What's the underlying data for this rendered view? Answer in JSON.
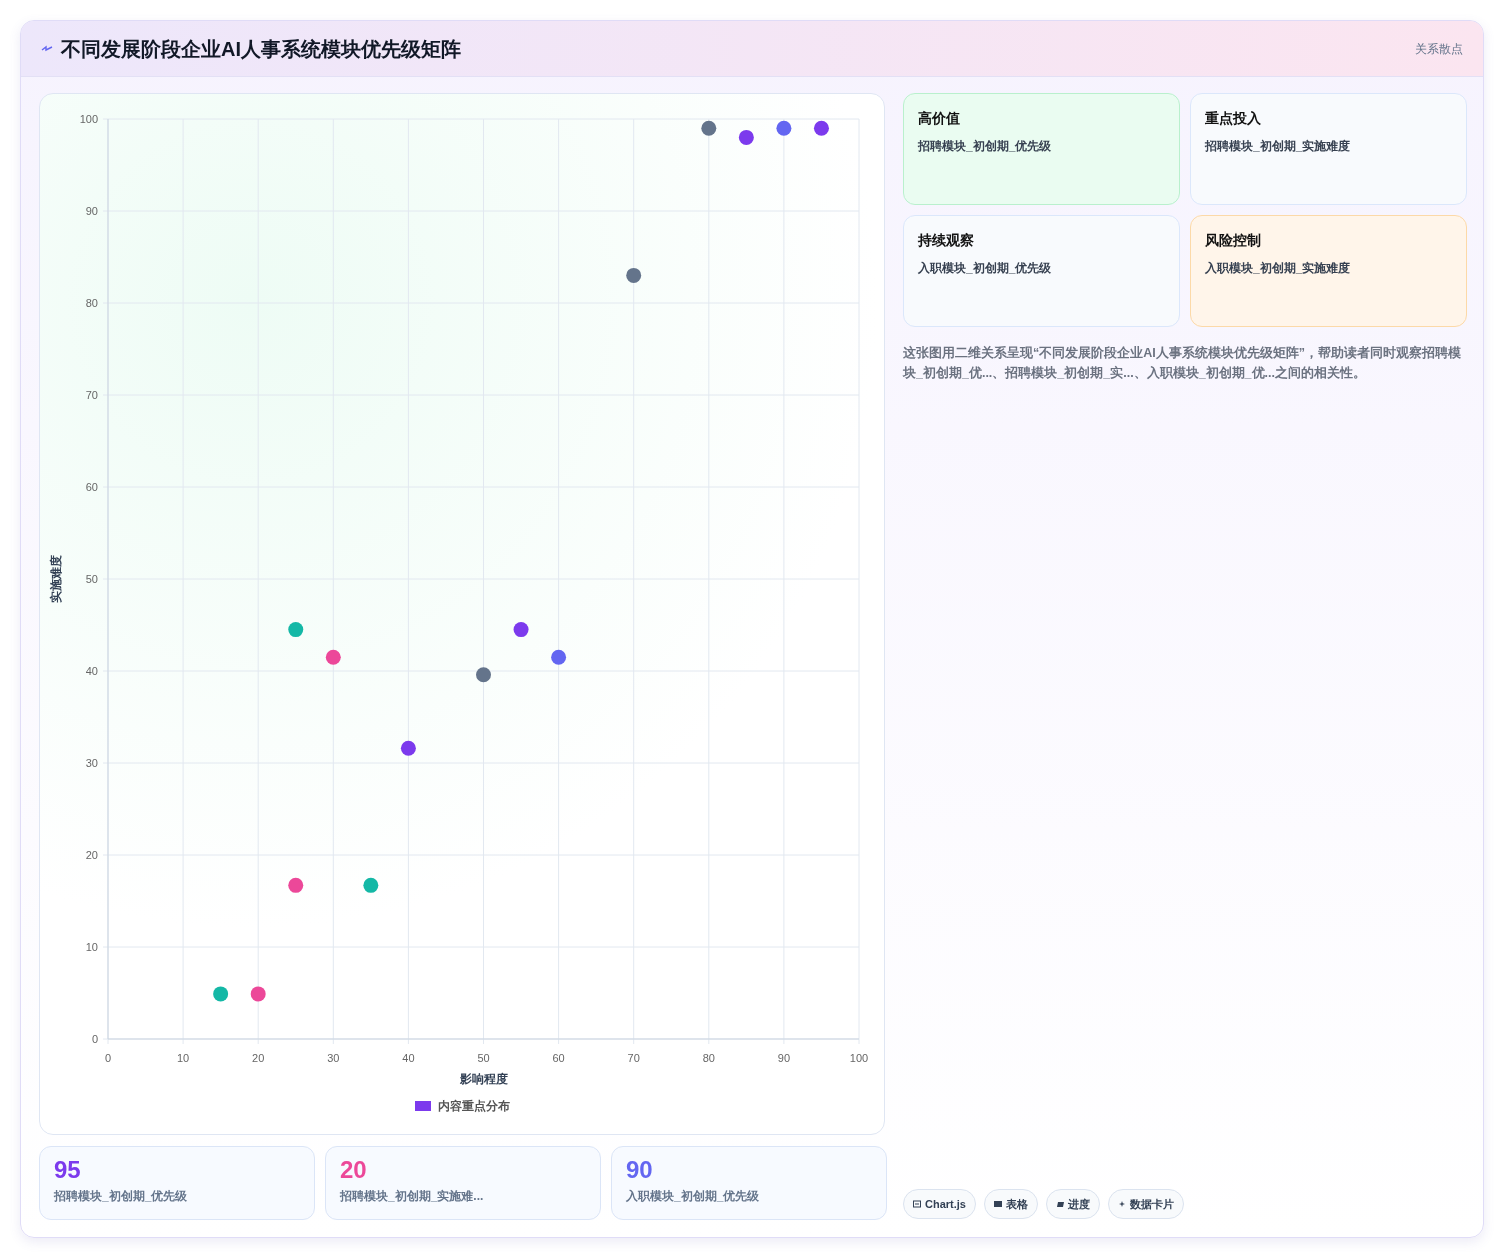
{
  "header": {
    "title": "不同发展阶段企业AI人事系统模块优先级矩阵",
    "tag": "关系散点"
  },
  "chart": {
    "chart_data": {
      "type": "scatter",
      "xlabel": "影响程度",
      "ylabel": "实施难度",
      "xlim": [
        0,
        100
      ],
      "ylim": [
        0,
        100
      ],
      "xticks": [
        0,
        10,
        20,
        30,
        40,
        50,
        60,
        70,
        80,
        90,
        100
      ],
      "yticks": [
        0,
        10,
        20,
        30,
        40,
        50,
        60,
        70,
        80,
        90,
        100
      ],
      "grid": true,
      "series": [
        {
          "name": "内容重点分布",
          "color": "#7c3aed",
          "x": [
            85,
            95,
            55,
            40
          ],
          "values": [
            98,
            99,
            44.5,
            31.6
          ]
        },
        {
          "color": "#64748b",
          "x": [
            80,
            70,
            50
          ],
          "values": [
            99,
            83,
            39.6
          ]
        },
        {
          "color": "#6366f1",
          "x": [
            90,
            60
          ],
          "values": [
            99,
            41.5
          ]
        },
        {
          "color": "#14b8a6",
          "x": [
            25,
            35,
            15
          ],
          "values": [
            44.5,
            16.7,
            4.9
          ]
        },
        {
          "color": "#ec4899",
          "x": [
            30,
            25,
            20
          ],
          "values": [
            41.5,
            16.7,
            4.9
          ]
        }
      ]
    }
  },
  "stats": [
    {
      "value": "95",
      "label": "招聘模块_初创期_优先级",
      "color": "#7c3aed"
    },
    {
      "value": "20",
      "label": "招聘模块_初创期_实施难...",
      "color": "#ec4899"
    },
    {
      "value": "90",
      "label": "入职模块_初创期_优先级",
      "color": "#6366f1"
    }
  ],
  "quadrants": [
    {
      "title": "高价值",
      "text": "招聘模块_初创期_优先级",
      "kind": "green"
    },
    {
      "title": "重点投入",
      "text": "招聘模块_初创期_实施难度",
      "kind": "plain"
    },
    {
      "title": "持续观察",
      "text": "入职模块_初创期_优先级",
      "kind": "plain"
    },
    {
      "title": "风险控制",
      "text": "入职模块_初创期_实施难度",
      "kind": "orange"
    }
  ],
  "description": "这张图用二维关系呈现“不同发展阶段企业AI人事系统模块优先级矩阵”，帮助读者同时观察招聘模块_初创期_优...、招聘模块_初创期_实...、入职模块_初创期_优...之间的相关性。",
  "chips": [
    {
      "label": "Chart.js",
      "kind": "chart"
    },
    {
      "label": "表格",
      "kind": "table"
    },
    {
      "label": "进度",
      "kind": "progress"
    },
    {
      "label": "数据卡片",
      "kind": "card"
    }
  ]
}
